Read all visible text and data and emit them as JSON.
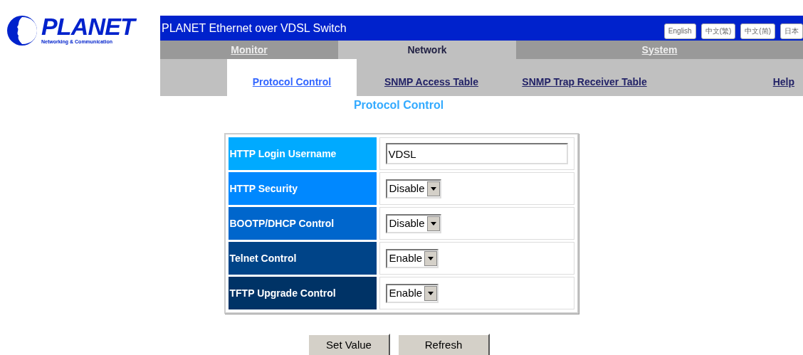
{
  "logo": {
    "name": "PLANET",
    "tagline": "Networking & Communication"
  },
  "banner": {
    "title": "PLANET Ethernet over VDSL Switch"
  },
  "languages": [
    {
      "label": "English"
    },
    {
      "label": "中文(繁)"
    },
    {
      "label": "中文(简)"
    },
    {
      "label": "日本"
    }
  ],
  "tabs": [
    {
      "label": "Monitor",
      "selected": false
    },
    {
      "label": "Network",
      "selected": true
    },
    {
      "label": "System",
      "selected": false
    }
  ],
  "subtabs": [
    {
      "label": "Protocol Control",
      "selected": true
    },
    {
      "label": "SNMP Access Table",
      "selected": false
    },
    {
      "label": "SNMP Trap Receiver Table",
      "selected": false
    },
    {
      "label": "Help",
      "selected": false
    }
  ],
  "page_title": "Protocol Control",
  "rows": [
    {
      "label": "HTTP Login Username",
      "color": "#00aaff",
      "kind": "text",
      "value": "VDSL"
    },
    {
      "label": "HTTP Security",
      "color": "#0088ff",
      "kind": "select",
      "value": "Disable"
    },
    {
      "label": "BOOTP/DHCP Control",
      "color": "#0066cc",
      "kind": "select",
      "value": "Disable"
    },
    {
      "label": "Telnet Control",
      "color": "#004488",
      "kind": "select",
      "value": "Enable"
    },
    {
      "label": "TFTP Upgrade Control",
      "color": "#003366",
      "kind": "select",
      "value": "Enable"
    }
  ],
  "buttons": [
    "Set Value",
    "Refresh"
  ]
}
